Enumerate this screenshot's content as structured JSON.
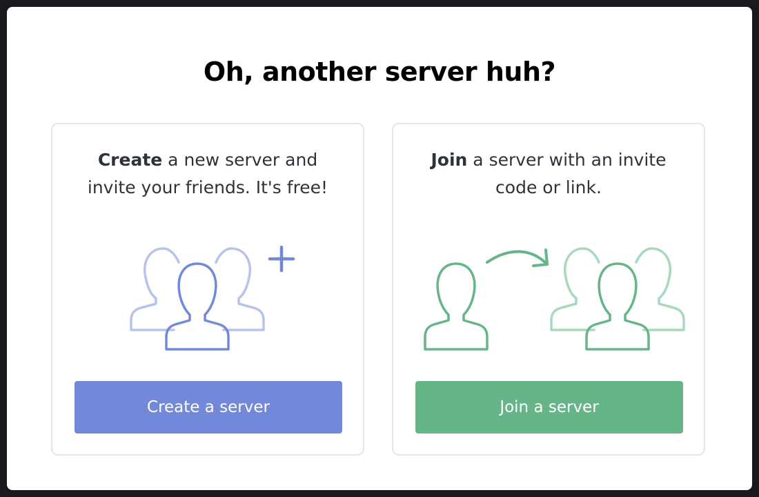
{
  "modal": {
    "title": "Oh, another server huh?"
  },
  "create_card": {
    "emphasis": "Create",
    "description_line1": " a new server and",
    "description_line2": "invite your friends. It's free!",
    "button_label": "Create a server",
    "icon": "people-add-icon",
    "accent_color": "#7289da"
  },
  "join_card": {
    "emphasis": "Join",
    "description_line1": " a server with an invite",
    "description_line2": "code or link.",
    "button_label": "Join a server",
    "icon": "people-join-icon",
    "accent_color": "#66b588"
  }
}
